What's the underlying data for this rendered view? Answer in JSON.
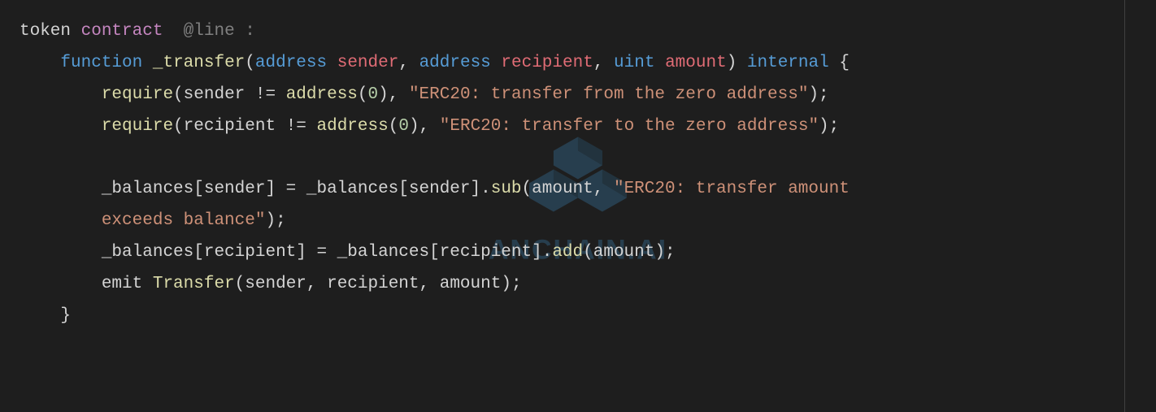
{
  "header": {
    "token": "token",
    "contract": "contract",
    "at": "@line",
    "colon": ":"
  },
  "line1": {
    "indent": "    ",
    "function_kw": "function",
    "space": " ",
    "func_name": "_transfer",
    "open": "(",
    "type1": "address",
    "param1": "sender",
    "comma1": ", ",
    "type2": "address",
    "param2": "recipient",
    "comma2": ", ",
    "type3": "uint",
    "param3": "amount",
    "close": ")",
    "internal": " internal ",
    "brace": "{"
  },
  "line2": {
    "indent": "        ",
    "require": "require",
    "open": "(",
    "var": "sender ",
    "neq": "!= ",
    "addr": "address",
    "paren_open": "(",
    "zero": "0",
    "paren_close": ")",
    "comma": ", ",
    "str": "\"ERC20: transfer from the zero address\"",
    "end": ");"
  },
  "line3": {
    "indent": "        ",
    "require": "require",
    "open": "(",
    "var": "recipient ",
    "neq": "!= ",
    "addr": "address",
    "paren_open": "(",
    "zero": "0",
    "paren_close": ")",
    "comma": ", ",
    "str": "\"ERC20: transfer to the zero address\"",
    "end": ");"
  },
  "line5": {
    "indent": "        ",
    "lhs": "_balances[sender] = _balances[sender].",
    "sub": "sub",
    "open": "(",
    "amt": "amount, ",
    "str": "\"ERC20: transfer amount "
  },
  "line6": {
    "indent": "        ",
    "str": "exceeds balance\"",
    "end": ");"
  },
  "line7": {
    "indent": "        ",
    "lhs": "_balances[recipient] = _balances[recipient].",
    "add": "add",
    "open": "(",
    "amt": "amount",
    "end": ");"
  },
  "line8": {
    "indent": "        ",
    "emit": "emit ",
    "transfer": "Transfer",
    "open": "(",
    "args": "sender, recipient, amount",
    "end": ");"
  },
  "line9": {
    "indent": "    ",
    "brace": "}"
  },
  "watermark": {
    "text": "ANCHAIN.AI"
  }
}
